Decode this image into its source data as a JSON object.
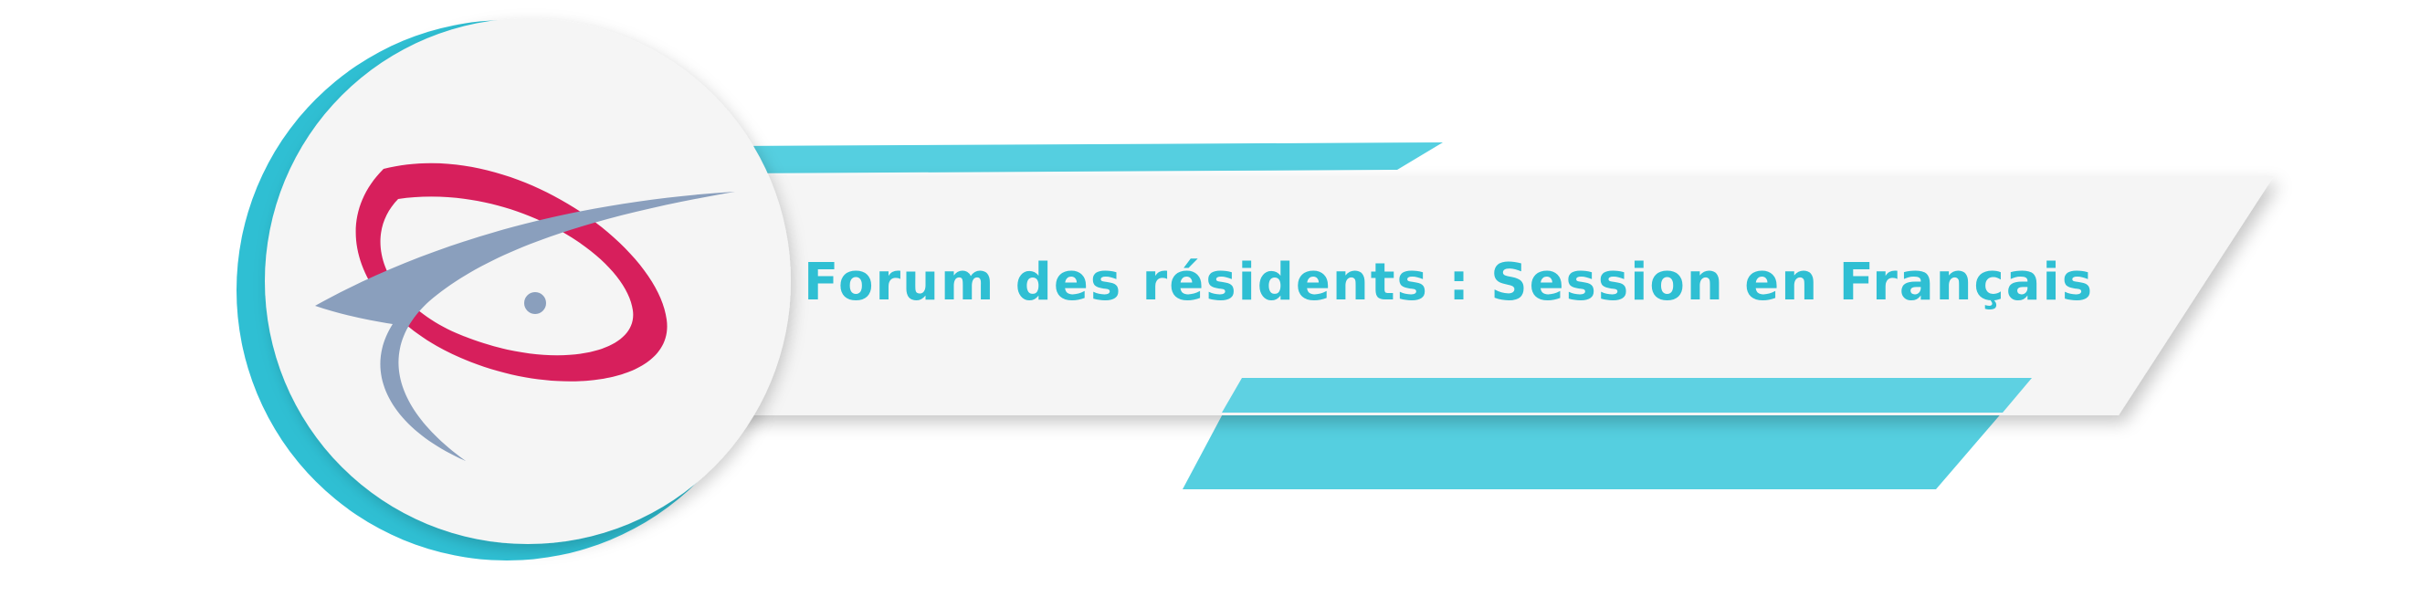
{
  "banner": {
    "title": "Forum des résidents : Session en Français"
  },
  "colors": {
    "accent": "#2fbfd3",
    "accent_band": "#55cfe0",
    "panel": "#f5f5f5",
    "logo_red": "#d71f5c",
    "logo_grey": "#8a9fbd"
  },
  "logo": {
    "icon": "swoosh-logo-icon"
  }
}
